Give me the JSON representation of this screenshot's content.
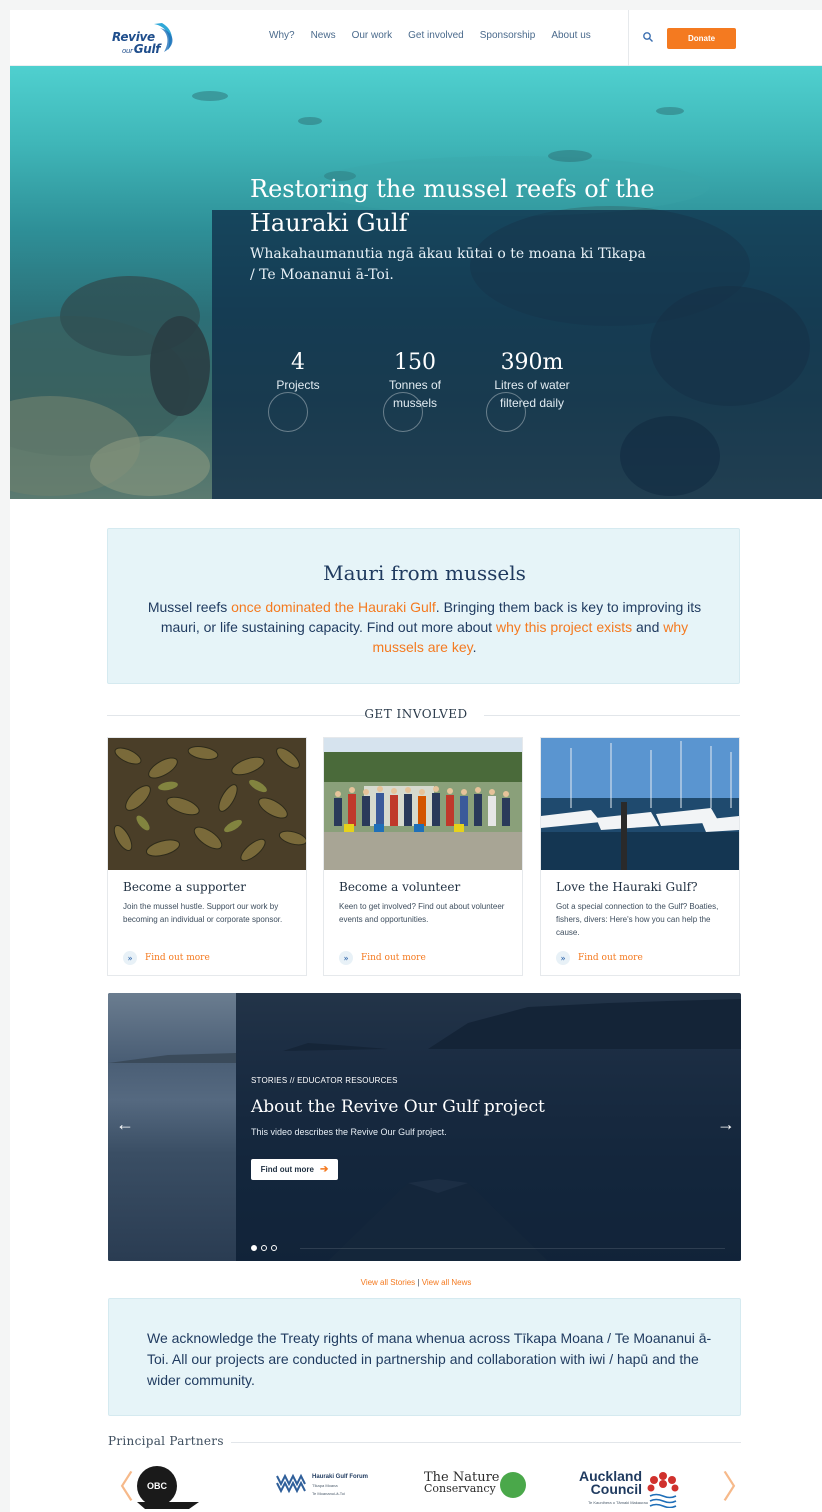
{
  "brand": {
    "logo_line1": "Revive",
    "logo_small": "our",
    "logo_line2": "Gulf",
    "orange": "#f47a20",
    "navy": "#1f3a5f"
  },
  "nav": {
    "items": [
      "Why?",
      "News",
      "Our work",
      "Get involved",
      "Sponsorship",
      "About us"
    ],
    "search_icon": "search-icon",
    "donate_label": "Donate"
  },
  "hero": {
    "title": "Restoring the mussel reefs of the Hauraki Gulf",
    "subtitle": "Whakahaumanutia ngā ākau kūtai o te moana ki Tīkapa / Te Moananui ā-Toi.",
    "stats": [
      {
        "value": "4",
        "label": "Projects"
      },
      {
        "value": "150",
        "label": "Tonnes of mussels"
      },
      {
        "value": "390m",
        "label": "Litres of water filtered daily"
      }
    ]
  },
  "mauri": {
    "title": "Mauri from mussels",
    "p1": "Mussel reefs ",
    "link1": "once dominated the Hauraki Gulf",
    "p2": ". Bringing them back is key to improving its mauri, or life sustaining capacity. Find out more about ",
    "link2": "why this project exists",
    "p3": " and ",
    "link3": "why mussels are key",
    "p4": "."
  },
  "get_involved": {
    "heading": "GET INVOLVED",
    "cards": [
      {
        "title": "Become a supporter",
        "text": "Join the mussel hustle. Support our work by becoming an individual or corporate sponsor.",
        "link": "Find out more"
      },
      {
        "title": "Become a volunteer",
        "text": "Keen to get involved? Find out about volunteer events and opportunities.",
        "link": "Find out more"
      },
      {
        "title": "Love the Hauraki Gulf?",
        "text": "Got a special connection to the Gulf? Boaties, fishers, divers: Here's how you can help the cause.",
        "link": "Find out more"
      }
    ]
  },
  "story": {
    "category": "STORIES // EDUCATOR RESOURCES",
    "title": "About the Revive Our Gulf project",
    "description": "This video describes the Revive Our Gulf project.",
    "button": "Find out more",
    "prev_arrow": "←",
    "next_arrow": "→",
    "slide_count": 3,
    "active_slide": 1
  },
  "view_links": {
    "stories": "View all Stories",
    "separator": " | ",
    "news": "View all News"
  },
  "acknowledgement": "We acknowledge the Treaty rights of mana whenua across Tīkapa Moana / Te Moananui ā-Toi.  All our projects are conducted in partnership and collaboration with iwi / hapū and the wider community.",
  "partners": {
    "heading": "Principal Partners",
    "prev": "〈",
    "next": "〉",
    "obc": "OBC",
    "hgf": {
      "name": "Hauraki Gulf Forum",
      "sub1": "Tīkapa Moana",
      "sub2": "Te Moananui-ā-Toi"
    },
    "tnc": {
      "line1": "The Nature",
      "line2": "Conservancy"
    },
    "ac": {
      "line1": "Auckland",
      "line2": "Council",
      "sub": "Te Kaunihera o Tāmaki Makaurau"
    }
  }
}
